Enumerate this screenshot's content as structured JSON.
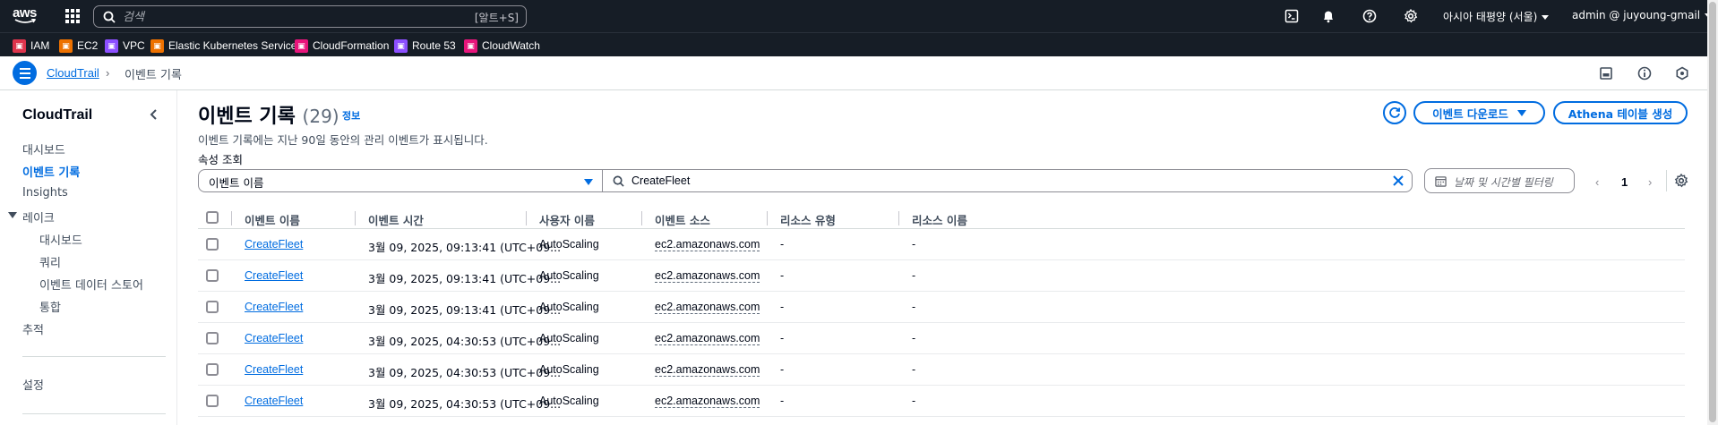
{
  "topnav": {
    "search_placeholder": "검색",
    "search_shortcut": "[알트+S]",
    "region": "아시아 태평양 (서울)",
    "account": "admin @ juyoung-gmail"
  },
  "favorites": [
    {
      "label": "IAM",
      "color": "#dd344c"
    },
    {
      "label": "EC2",
      "color": "#ed7100"
    },
    {
      "label": "VPC",
      "color": "#8c4fff"
    },
    {
      "label": "Elastic Kubernetes Service",
      "color": "#ed7100"
    },
    {
      "label": "CloudFormation",
      "color": "#e7157b"
    },
    {
      "label": "Route 53",
      "color": "#8c4fff"
    },
    {
      "label": "CloudWatch",
      "color": "#e7157b"
    }
  ],
  "breadcrumb": {
    "root": "CloudTrail",
    "separator": "›",
    "current": "이벤트 기록"
  },
  "sidebar": {
    "title": "CloudTrail",
    "items": [
      {
        "label": "대시보드"
      },
      {
        "label": "이벤트 기록"
      },
      {
        "label": "Insights"
      },
      {
        "label": "레이크"
      },
      {
        "label": "대시보드"
      },
      {
        "label": "쿼리"
      },
      {
        "label": "이벤트 데이터 스토어"
      },
      {
        "label": "통합"
      },
      {
        "label": "추적"
      },
      {
        "label": "설정"
      }
    ]
  },
  "main": {
    "title": "이벤트 기록",
    "count": "(29)",
    "info_link": "정보",
    "description": "이벤트 기록에는 지난 90일 동안의 관리 이벤트가 표시됩니다.",
    "download_button": "이벤트 다운로드",
    "athena_button": "Athena 테이블 생성",
    "lookup_label": "속성 조회",
    "lookup_attribute": "이벤트 이름",
    "lookup_value": "CreateFleet",
    "date_filter_placeholder": "날짜 및 시간별 필터링",
    "page_number": "1",
    "prev_glyph": "‹",
    "next_glyph": "›"
  },
  "table": {
    "columns": [
      "이벤트 이름",
      "이벤트 시간",
      "사용자 이름",
      "이벤트 소스",
      "리소스 유형",
      "리소스 이름"
    ],
    "rows": [
      {
        "event_name": "CreateFleet",
        "event_time": "3월 09, 2025, 09:13:41 (UTC+09...",
        "user_name": "AutoScaling",
        "event_source": "ec2.amazonaws.com",
        "resource_type": "-",
        "resource_name": "-"
      },
      {
        "event_name": "CreateFleet",
        "event_time": "3월 09, 2025, 09:13:41 (UTC+09...",
        "user_name": "AutoScaling",
        "event_source": "ec2.amazonaws.com",
        "resource_type": "-",
        "resource_name": "-"
      },
      {
        "event_name": "CreateFleet",
        "event_time": "3월 09, 2025, 09:13:41 (UTC+09...",
        "user_name": "AutoScaling",
        "event_source": "ec2.amazonaws.com",
        "resource_type": "-",
        "resource_name": "-"
      },
      {
        "event_name": "CreateFleet",
        "event_time": "3월 09, 2025, 04:30:53 (UTC+09...",
        "user_name": "AutoScaling",
        "event_source": "ec2.amazonaws.com",
        "resource_type": "-",
        "resource_name": "-"
      },
      {
        "event_name": "CreateFleet",
        "event_time": "3월 09, 2025, 04:30:53 (UTC+09...",
        "user_name": "AutoScaling",
        "event_source": "ec2.amazonaws.com",
        "resource_type": "-",
        "resource_name": "-"
      },
      {
        "event_name": "CreateFleet",
        "event_time": "3월 09, 2025, 04:30:53 (UTC+09...",
        "user_name": "AutoScaling",
        "event_source": "ec2.amazonaws.com",
        "resource_type": "-",
        "resource_name": "-"
      }
    ]
  },
  "icons": {
    "topnav": [
      "cloudshell-icon",
      "bell-icon",
      "help-icon",
      "gear-icon"
    ],
    "crumbbar": [
      "panel-icon",
      "info-icon",
      "feedback-icon"
    ]
  },
  "colors": {
    "nav_bg": "#161d26",
    "accent": "#006ce0",
    "text": "#000716"
  }
}
